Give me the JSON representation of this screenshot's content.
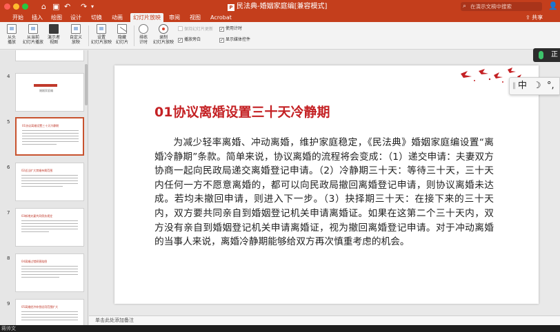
{
  "window": {
    "title": "民法典-婚姻家庭编[兼容模式]",
    "app_badge": "P",
    "search_placeholder": "在演示文稿中搜索",
    "share_label": "共享",
    "brand_color": "#c43e1c"
  },
  "quick_access": {
    "home_icon": "home-icon",
    "save_icon": "save-icon",
    "undo_icon": "undo-icon",
    "redo_icon": "redo-icon"
  },
  "tabs": [
    {
      "label": "开始"
    },
    {
      "label": "插入"
    },
    {
      "label": "绘图"
    },
    {
      "label": "设计"
    },
    {
      "label": "切换"
    },
    {
      "label": "动画"
    },
    {
      "label": "幻灯片放映",
      "active": true
    },
    {
      "label": "审阅"
    },
    {
      "label": "视图"
    },
    {
      "label": "Acrobat"
    }
  ],
  "ribbon": {
    "buttons": [
      {
        "l1": "从头",
        "l2": "播放"
      },
      {
        "l1": "从当前",
        "l2": "幻灯片播放"
      },
      {
        "l1": "演示者",
        "l2": "视图"
      },
      {
        "l1": "自定义",
        "l2": "放映"
      },
      {
        "l1": "设置",
        "l2": "幻灯片放映"
      },
      {
        "l1": "隐藏",
        "l2": "幻灯片"
      },
      {
        "l1": "排练",
        "l2": "计时"
      },
      {
        "l1": "录制",
        "l2": "幻灯片放映"
      }
    ],
    "checks": [
      {
        "label": "保持幻灯片更新",
        "checked": false,
        "disabled": true
      },
      {
        "label": "播放旁白",
        "checked": true,
        "disabled": false
      },
      {
        "label": "使用计时",
        "checked": true,
        "disabled": false
      },
      {
        "label": "显示媒体控件",
        "checked": true,
        "disabled": false
      }
    ]
  },
  "thumbnails": [
    {
      "num": "4",
      "title": "婚姻家庭编"
    },
    {
      "num": "5",
      "title": "01协议离婚设置三十天冷静期",
      "selected": true
    },
    {
      "num": "6",
      "title": "02适当扩大禁婚亲属范围"
    },
    {
      "num": "7",
      "title": "03新增夫妻共同债务规定"
    },
    {
      "num": "8",
      "title": "04离婚过错损害赔偿"
    },
    {
      "num": "9",
      "title": "05离婚经济补偿适用范围扩大"
    }
  ],
  "slide": {
    "title": "01协议离婚设置三十天冷静期",
    "body": "为减少轻率离婚、冲动离婚，维护家庭稳定，《民法典》婚姻家庭编设置“离婚冷静期”条款。简单来说，协议离婚的流程将会变成：（1）递交申请：夫妻双方协商一起向民政局递交离婚登记申请。（2）冷静期三十天：等待三十天，三十天内任何一方不愿意离婚的，都可以向民政局撤回离婚登记申请，则协议离婚未达成。若均未撤回申请，则进入下一步。（3）抉择期三十天：在接下来的三十天内，双方要共同亲自到婚姻登记机关申请离婚证。如果在这第二个三十天内，双方没有亲自到婚姻登记机关申请离婚证，视为撤回离婚登记申请。对于冲动离婚的当事人来说，离婚冷静期能够给双方再次慎重考虑的机会。"
  },
  "notes_placeholder": "单击此处添加备注",
  "overlays": {
    "mic_label": "正",
    "ime_mode": "中",
    "ime_moon": "☽",
    "ime_punct": "°,"
  },
  "bottom_text": "蒋帅文"
}
